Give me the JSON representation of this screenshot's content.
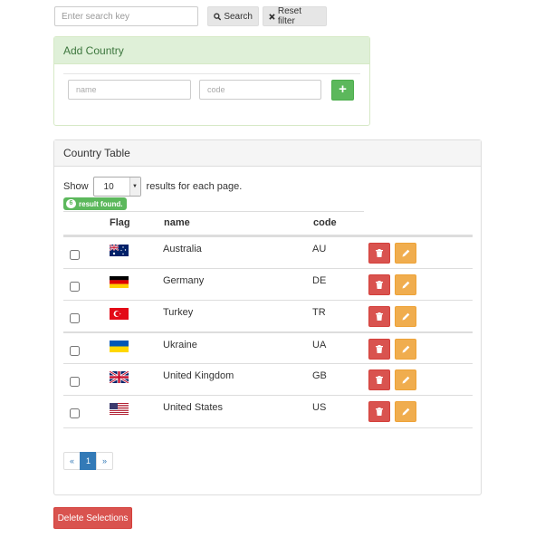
{
  "search": {
    "placeholder": "Enter search key",
    "search_label": "Search",
    "reset_label": "Reset filter"
  },
  "add_country": {
    "title": "Add Country",
    "name_placeholder": "name",
    "code_placeholder": "code",
    "add_button": "+"
  },
  "table": {
    "title": "Country Table",
    "show_label": "Show",
    "page_size": "10",
    "results_label": "results for each page.",
    "result_count": "6",
    "result_found_label": "result found.",
    "columns": {
      "flag": "Flag",
      "name": "name",
      "code": "code"
    },
    "rows": [
      {
        "name": "Australia",
        "code": "AU",
        "flag_icon": "flag-au-icon"
      },
      {
        "name": "Germany",
        "code": "DE",
        "flag_icon": "flag-de-icon"
      },
      {
        "name": "Turkey",
        "code": "TR",
        "flag_icon": "flag-tr-icon"
      },
      {
        "name": "Ukraine",
        "code": "UA",
        "flag_icon": "flag-ua-icon"
      },
      {
        "name": "United Kingdom",
        "code": "GB",
        "flag_icon": "flag-gb-icon"
      },
      {
        "name": "United States",
        "code": "US",
        "flag_icon": "flag-us-icon"
      }
    ],
    "pagination": {
      "prev": "«",
      "current": "1",
      "next": "»"
    }
  },
  "delete_selections_label": "Delete Selections",
  "colors": {
    "success": "#5cb85c",
    "danger": "#d9534f",
    "warning": "#f0ad4e",
    "primary": "#337ab7"
  }
}
